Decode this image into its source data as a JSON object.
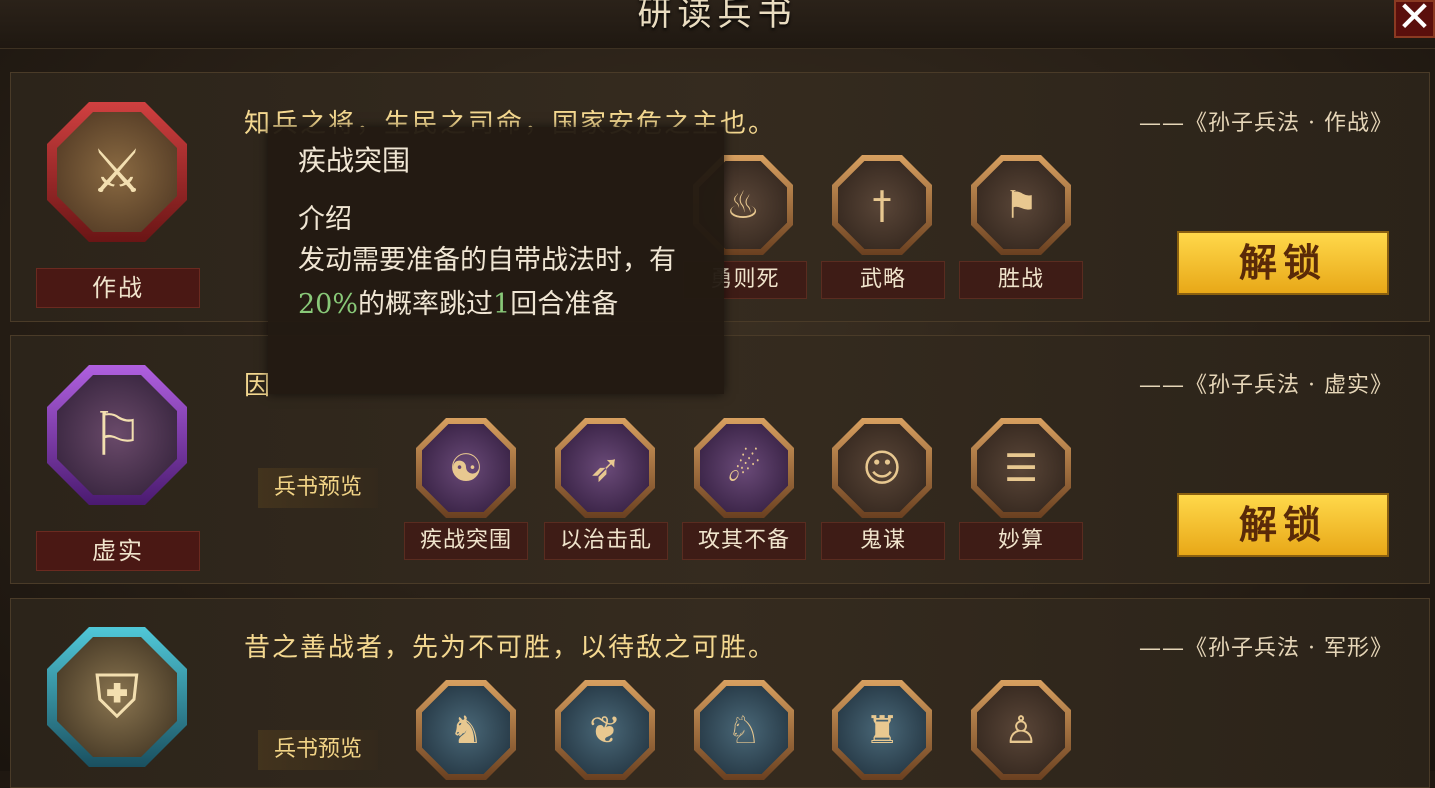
{
  "window": {
    "title": "研读兵书",
    "close_icon": "close-icon"
  },
  "sections": [
    {
      "name": "作战",
      "quote": "知兵之将，生民之司命，国家安危之主也。",
      "source": "——《孙子兵法 · 作战》",
      "emblem_icon": "crossed-swords-icon",
      "skills": [
        {
          "name": "勇则死"
        },
        {
          "name": "武略"
        },
        {
          "name": "胜战"
        }
      ],
      "unlock_label": "解锁"
    },
    {
      "name": "虚实",
      "quote": "因",
      "source": "——《孙子兵法 · 虚实》",
      "emblem_icon": "flag-flame-icon",
      "preview_label": "兵书预览",
      "skills": [
        {
          "name": "疾战突围"
        },
        {
          "name": "以治击乱"
        },
        {
          "name": "攻其不备"
        },
        {
          "name": "鬼谋"
        },
        {
          "name": "妙算"
        }
      ],
      "unlock_label": "解锁"
    },
    {
      "name": "军形",
      "quote": "昔之善战者，先为不可胜，以待敌之可胜。",
      "source": "——《孙子兵法 · 军形》",
      "emblem_icon": "shield-arrow-icon",
      "preview_label": "兵书预览"
    }
  ],
  "tooltip": {
    "title": "疾战突围",
    "label": "介绍",
    "desc_a": "发动需要准备的自带战法时，有",
    "desc_pct": "20%",
    "desc_b": "的概率跳过",
    "desc_n": "1",
    "desc_c": "回合准备"
  },
  "colors": {
    "quote": "#f4d890",
    "unlock_button": "#f5c530",
    "highlight": "#88c878"
  }
}
